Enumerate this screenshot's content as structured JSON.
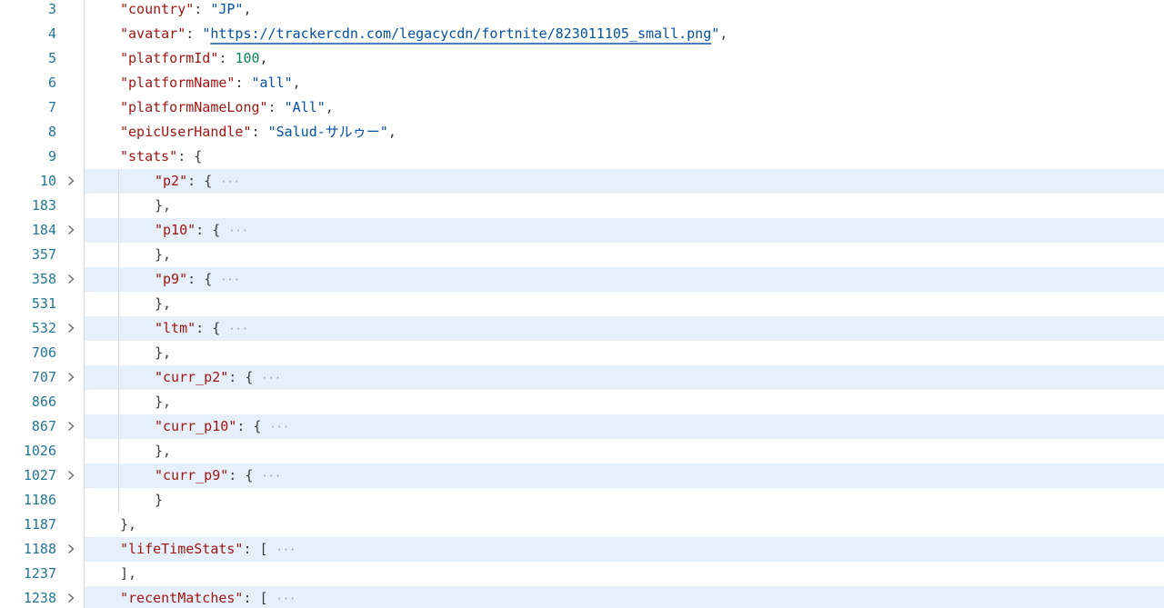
{
  "lines": [
    {
      "num": "3",
      "depth": 1,
      "key": "\"country\"",
      "sep": ": ",
      "value": "\"JP\"",
      "type": "string",
      "tail": ","
    },
    {
      "num": "4",
      "depth": 1,
      "key": "\"avatar\"",
      "sep": ": ",
      "q1": "\"",
      "url": "https://trackercdn.com/legacycdn/fortnite/823011105_small.png",
      "q2": "\"",
      "type": "url",
      "tail": ","
    },
    {
      "num": "5",
      "depth": 1,
      "key": "\"platformId\"",
      "sep": ": ",
      "value": "100",
      "type": "number",
      "tail": ","
    },
    {
      "num": "6",
      "depth": 1,
      "key": "\"platformName\"",
      "sep": ": ",
      "value": "\"all\"",
      "type": "string",
      "tail": ","
    },
    {
      "num": "7",
      "depth": 1,
      "key": "\"platformNameLong\"",
      "sep": ": ",
      "value": "\"All\"",
      "type": "string",
      "tail": ","
    },
    {
      "num": "8",
      "depth": 1,
      "key": "\"epicUserHandle\"",
      "sep": ": ",
      "value": "\"Salud-サルゥー\"",
      "type": "string",
      "tail": ","
    },
    {
      "num": "9",
      "depth": 1,
      "key": "\"stats\"",
      "sep": ": ",
      "value": "{",
      "type": "punct",
      "tail": ""
    },
    {
      "num": "10",
      "depth": 2,
      "key": "\"p2\"",
      "sep": ": ",
      "value": "{",
      "type": "punct",
      "tail": "",
      "folded": true,
      "ellipsis": "···"
    },
    {
      "num": "183",
      "depth": 2,
      "text": "},",
      "type": "plain"
    },
    {
      "num": "184",
      "depth": 2,
      "key": "\"p10\"",
      "sep": ": ",
      "value": "{",
      "type": "punct",
      "tail": "",
      "folded": true,
      "ellipsis": "···"
    },
    {
      "num": "357",
      "depth": 2,
      "text": "},",
      "type": "plain"
    },
    {
      "num": "358",
      "depth": 2,
      "key": "\"p9\"",
      "sep": ": ",
      "value": "{",
      "type": "punct",
      "tail": "",
      "folded": true,
      "ellipsis": "···"
    },
    {
      "num": "531",
      "depth": 2,
      "text": "},",
      "type": "plain"
    },
    {
      "num": "532",
      "depth": 2,
      "key": "\"ltm\"",
      "sep": ": ",
      "value": "{",
      "type": "punct",
      "tail": "",
      "folded": true,
      "ellipsis": "···"
    },
    {
      "num": "706",
      "depth": 2,
      "text": "},",
      "type": "plain"
    },
    {
      "num": "707",
      "depth": 2,
      "key": "\"curr_p2\"",
      "sep": ": ",
      "value": "{",
      "type": "punct",
      "tail": "",
      "folded": true,
      "ellipsis": "···"
    },
    {
      "num": "866",
      "depth": 2,
      "text": "},",
      "type": "plain"
    },
    {
      "num": "867",
      "depth": 2,
      "key": "\"curr_p10\"",
      "sep": ": ",
      "value": "{",
      "type": "punct",
      "tail": "",
      "folded": true,
      "ellipsis": "···"
    },
    {
      "num": "1026",
      "depth": 2,
      "text": "},",
      "type": "plain"
    },
    {
      "num": "1027",
      "depth": 2,
      "key": "\"curr_p9\"",
      "sep": ": ",
      "value": "{",
      "type": "punct",
      "tail": "",
      "folded": true,
      "ellipsis": "···"
    },
    {
      "num": "1186",
      "depth": 2,
      "text": "}",
      "type": "plain"
    },
    {
      "num": "1187",
      "depth": 1,
      "text": "},",
      "type": "plain"
    },
    {
      "num": "1188",
      "depth": 1,
      "key": "\"lifeTimeStats\"",
      "sep": ": ",
      "value": "[",
      "type": "punct",
      "tail": "",
      "folded": true,
      "ellipsis": "···"
    },
    {
      "num": "1237",
      "depth": 1,
      "text": "],",
      "type": "plain"
    },
    {
      "num": "1238",
      "depth": 1,
      "key": "\"recentMatches\"",
      "sep": ": ",
      "value": "[",
      "type": "punct",
      "tail": "",
      "folded": true,
      "ellipsis": "···"
    }
  ],
  "colors": {
    "line_number": "#237893",
    "key": "#a31515",
    "string": "#0451a5",
    "number": "#098658",
    "fold_highlight": "#e5f0fb"
  }
}
